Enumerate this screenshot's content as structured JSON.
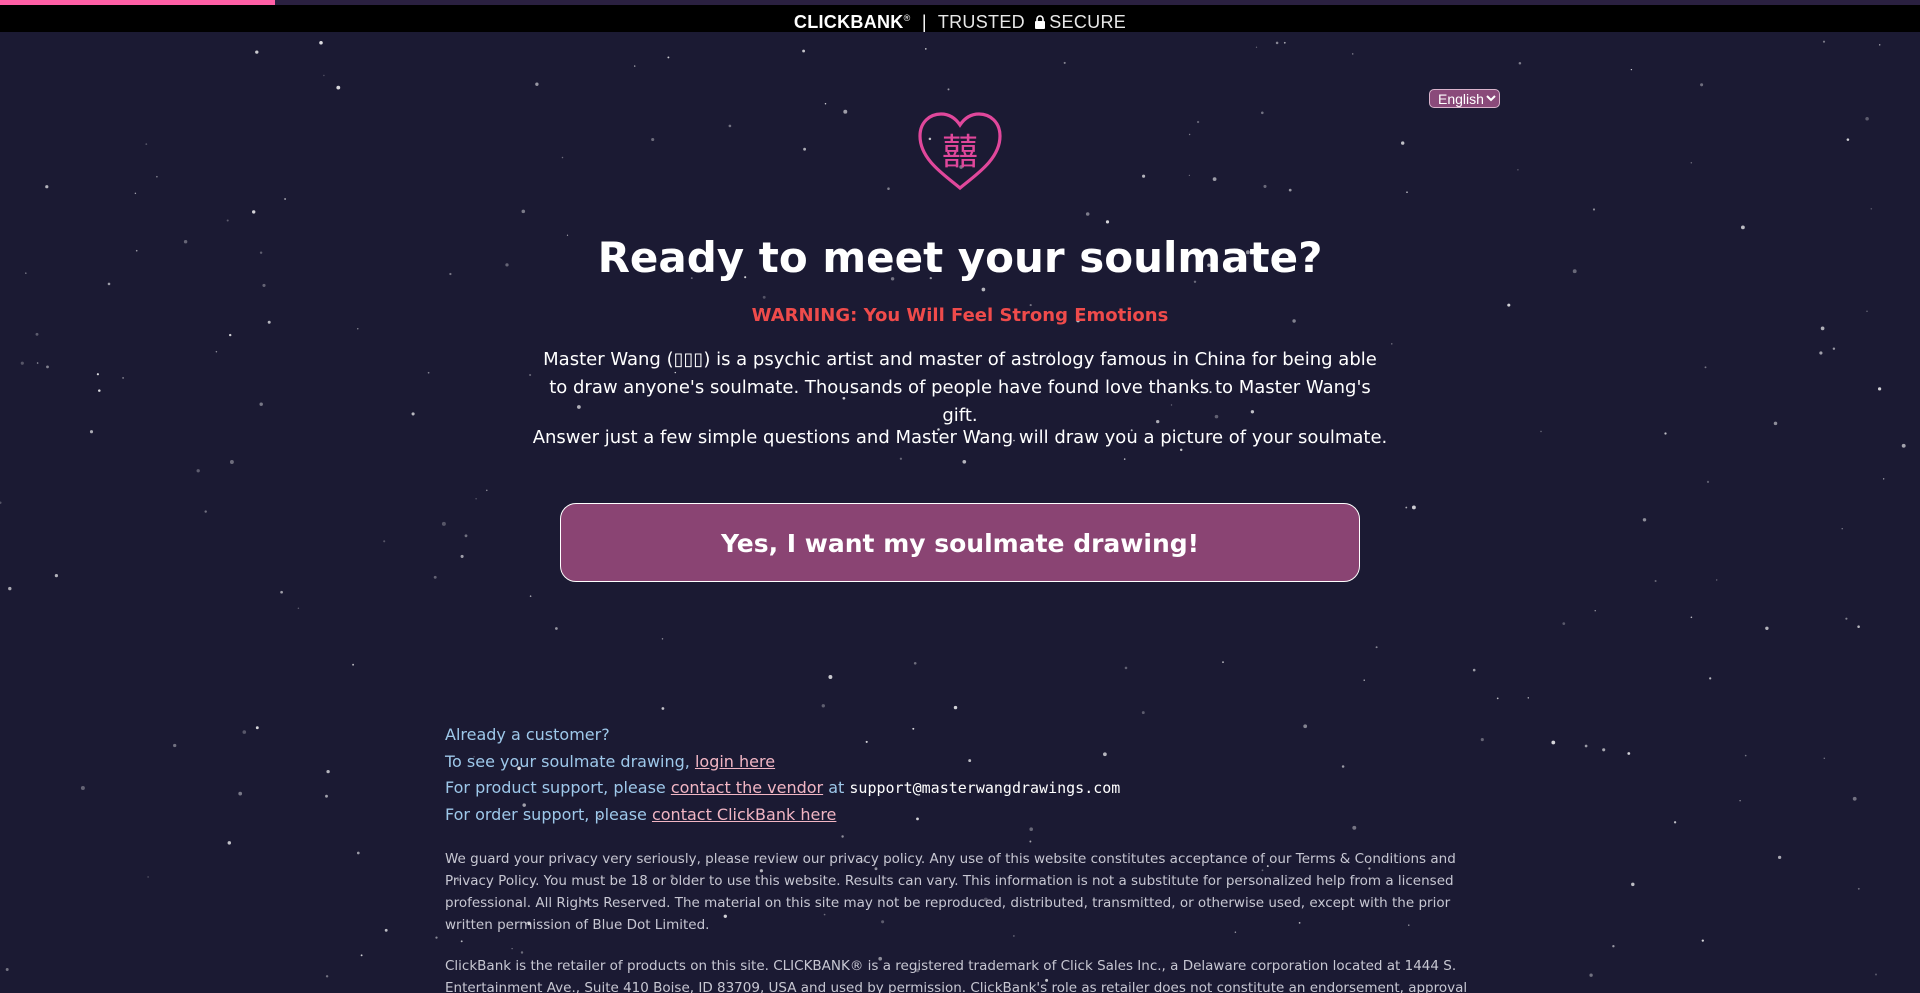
{
  "top_bar": {
    "progress_percent": 14.3,
    "progress_color": "#ff5fa6",
    "brand_name": "CLICKBANK",
    "brand_mark": "®",
    "separator": "|",
    "trusted": "TRUSTED",
    "secure": "SECURE",
    "lock_icon": "lock-icon"
  },
  "language": {
    "selected": "English"
  },
  "logo": {
    "icon": "heart-double-happiness-icon",
    "glyph": "囍",
    "color": "#e0479b"
  },
  "hero": {
    "headline": "Ready to meet your soulmate?",
    "warning": "WARNING: You Will Feel Strong Emotions",
    "warning_color": "#ef4b4b",
    "intro": "Master Wang (▯▯▯) is a psychic artist and master of astrology famous in China for being able to draw anyone's soulmate. Thousands of people have found love thanks to Master Wang's gift.",
    "sub": "Answer just a few simple questions and Master Wang will draw you a picture of your soulmate.",
    "cta_label": "Yes, I want my soulmate drawing!",
    "cta_color": "#8a4473"
  },
  "support": {
    "already_customer": "Already a customer?",
    "see_drawing_prefix": "To see your soulmate drawing,",
    "login_link": "login here",
    "product_support_prefix": "For product support, please",
    "contact_vendor_link": "contact the vendor",
    "at_text": "at",
    "support_email": "support@masterwangdrawings.com",
    "order_support_prefix": "For order support, please",
    "contact_clickbank_link": "contact ClickBank here"
  },
  "legal": {
    "privacy": "We guard your privacy very seriously, please review our privacy policy. Any use of this website constitutes acceptance of our Terms & Conditions and Privacy Policy. You must be 18 or older to use this website. Results can vary. This information is not a substitute for personalized help from a licensed professional. All Rights Reserved. The material on this site may not be reproduced, distributed, transmitted, or otherwise used, except with the prior written permission of Blue Dot Limited.",
    "clickbank": "ClickBank is the retailer of products on this site. CLICKBANK® is a registered trademark of Click Sales Inc., a Delaware corporation located at 1444 S. Entertainment Ave., Suite 410 Boise, ID 83709, USA and used by permission. ClickBank's role as retailer does not constitute an endorsement, approval or review of these products"
  }
}
